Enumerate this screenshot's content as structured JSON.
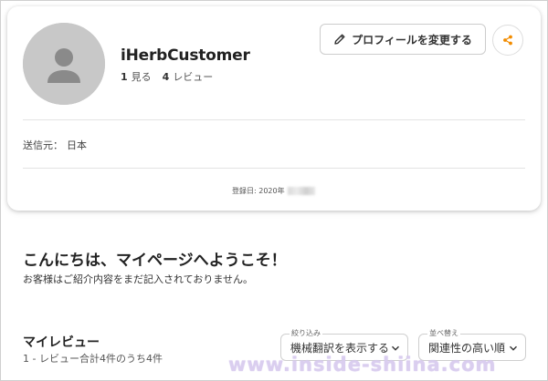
{
  "profile": {
    "name": "iHerbCustomer",
    "stats": {
      "views_count": "1",
      "views_label": "見る",
      "reviews_count": "4",
      "reviews_label": "レビュー"
    },
    "edit_button_label": "プロフィールを変更する",
    "from_label": "送信元：",
    "from_value": "日本",
    "registered_label": "登録日: 2020年"
  },
  "welcome": {
    "title": "こんにちは、マイページへようこそ！",
    "subtitle": "お客様はご紹介内容をまだ記入されておりません。"
  },
  "reviews": {
    "heading": "マイレビュー",
    "count_text": "1 - レビュー合計4件のうち4件",
    "filter": {
      "label": "絞り込み",
      "value": "機械翻訳を表示する"
    },
    "sort": {
      "label": "並べ替え",
      "value": "関連性の高い順"
    }
  },
  "watermark": "www.inside-shiina.com",
  "icons": {
    "avatar": "person-placeholder-icon",
    "edit": "pencil-icon",
    "share": "share-icon",
    "dropdown": "chevron-down-icon"
  },
  "colors": {
    "accent": "#f28c00",
    "avatar_bg": "#c8c8c8",
    "watermark": "#d9ccef"
  }
}
